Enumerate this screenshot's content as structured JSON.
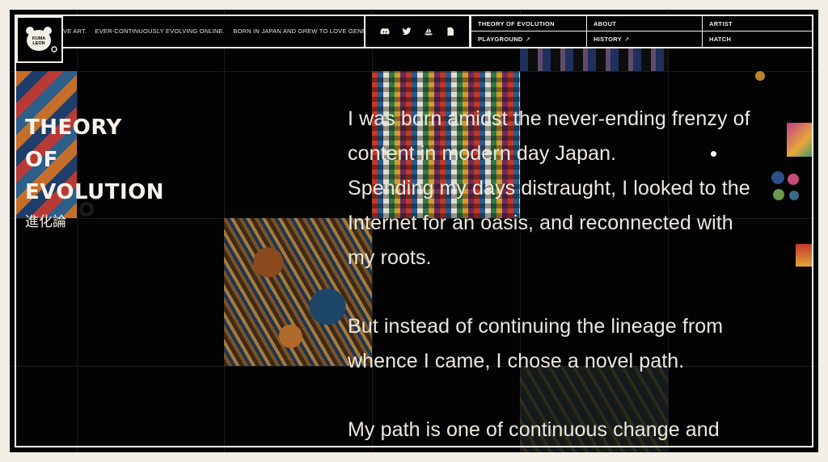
{
  "header": {
    "logo_line1": "KUMA",
    "logo_line2": "LEON",
    "ticker": [
      "VE ART.",
      "EVER-CONTINUOUSLY EVOLVING ONLINE.",
      "BORN IN JAPAN AND GREW TO LOVE GENE"
    ],
    "social_icons": [
      "discord-icon",
      "twitter-icon",
      "opensea-icon",
      "document-icon"
    ]
  },
  "nav": {
    "theory": "THEORY OF EVOLUTION",
    "about": "ABOUT",
    "artist": "ARTIST",
    "playground": "PLAYGROUND",
    "history": "HISTORY",
    "hatch": "HATCH",
    "external_arrow": "↗"
  },
  "title": {
    "line1": "THEORY",
    "line2": "OF",
    "line3": "EVOLUTION",
    "japanese": "進化論"
  },
  "story": {
    "p1": [
      "I was born amidst the never-ending frenzy of",
      "content in modern day Japan.",
      "Spending my days distraught, I looked to the",
      "Internet for an oasis, and reconnected with",
      "my roots."
    ],
    "p2": [
      "But instead of continuing the lineage from",
      "whence I came, I chose a novel path."
    ],
    "p3": [
      "My path is one of continuous change and"
    ]
  },
  "colors": {
    "background": "#030303",
    "frame": "#f3efe6",
    "text": "#ece8de"
  }
}
